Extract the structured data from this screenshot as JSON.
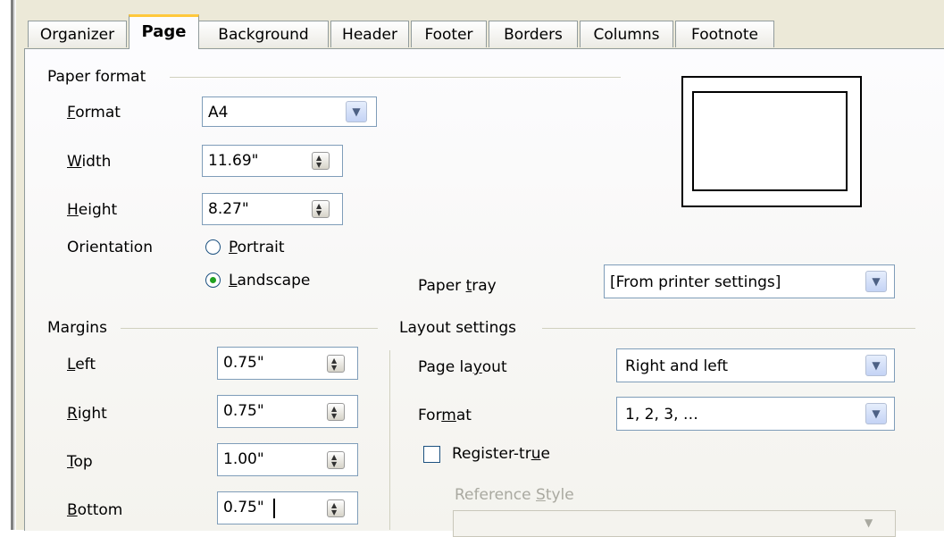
{
  "tabs": [
    {
      "label": "Organizer",
      "active": false
    },
    {
      "label": "Page",
      "active": true
    },
    {
      "label": "Background",
      "active": false
    },
    {
      "label": "Header",
      "active": false
    },
    {
      "label": "Footer",
      "active": false
    },
    {
      "label": "Borders",
      "active": false
    },
    {
      "label": "Columns",
      "active": false
    },
    {
      "label": "Footnote",
      "active": false
    }
  ],
  "paper_format": {
    "title": "Paper format",
    "format_label": "Format",
    "format_value": "A4",
    "width_label": "Width",
    "width_value": "11.69\"",
    "height_label": "Height",
    "height_value": "8.27\"",
    "orientation_label": "Orientation",
    "portrait_label": "Portrait",
    "landscape_label": "Landscape",
    "selected_orientation": "Landscape",
    "paper_tray_label": "Paper tray",
    "paper_tray_value": "[From printer settings]"
  },
  "margins": {
    "title": "Margins",
    "left_label": "Left",
    "left_value": "0.75\"",
    "right_label": "Right",
    "right_value": "0.75\"",
    "top_label": "Top",
    "top_value": "1.00\"",
    "bottom_label": "Bottom",
    "bottom_value": "0.75\""
  },
  "layout": {
    "title": "Layout settings",
    "page_layout_label": "Page layout",
    "page_layout_value": "Right and left",
    "format_label": "Format",
    "format_value": "1, 2, 3, …",
    "register_true_label": "Register-true",
    "register_true_checked": false,
    "reference_style_label": "Reference Style",
    "reference_style_value": ""
  },
  "icons": {
    "spin": "spin-button-icon",
    "dropdown": "chevron-down-icon"
  },
  "colors": {
    "active_tab_accent": "#ffc83c",
    "radio_dot": "#21a121",
    "input_border": "#7f9db9"
  }
}
